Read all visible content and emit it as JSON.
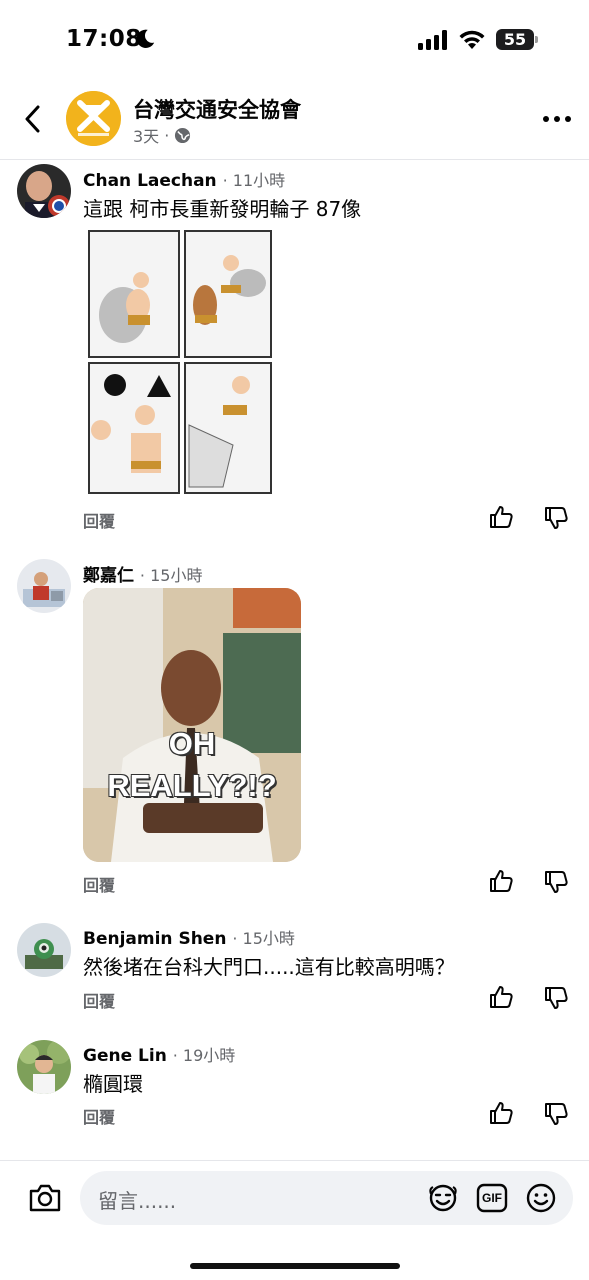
{
  "status_bar": {
    "time": "17:08",
    "battery": "55"
  },
  "header": {
    "page_name": "台灣交通安全協會",
    "post_age": "3天",
    "separator": "·"
  },
  "comments": [
    {
      "author": "Chan Laechan",
      "time": "11小時",
      "text": "這跟 柯市長重新發明輪子 87像",
      "reply": "回覆",
      "attachment": "comic-image"
    },
    {
      "author": "鄭嘉仁",
      "time": "15小時",
      "text": "",
      "reply": "回覆",
      "attachment": "gif",
      "gif_line1": "OH",
      "gif_line2": "REALLY?!?"
    },
    {
      "author": "Benjamin Shen",
      "time": "15小時",
      "text": "然後堵在台科大門口.....這有比較高明嗎？",
      "reply": "回覆"
    },
    {
      "author": "Gene Lin",
      "time": "19小時",
      "text": "橢圓環",
      "reply": "回覆"
    }
  ],
  "composer": {
    "placeholder": "留言......",
    "gif_label": "GIF"
  },
  "icons": [
    "back-arrow",
    "more-dots",
    "like",
    "dislike",
    "camera",
    "avatar-sticker",
    "gif",
    "emoji",
    "globe",
    "moon"
  ]
}
